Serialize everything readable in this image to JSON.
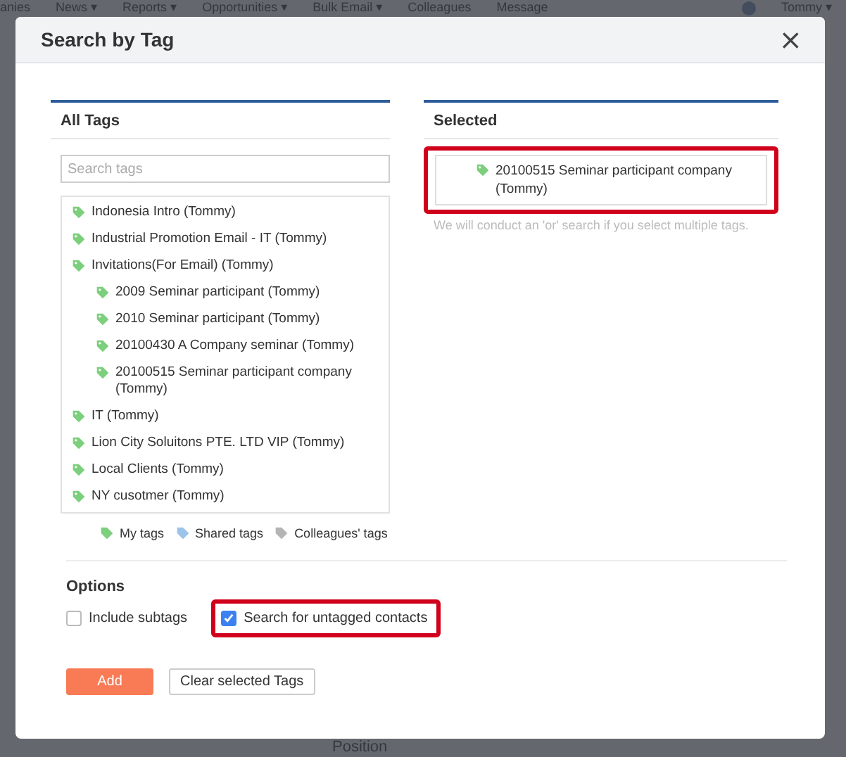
{
  "background": {
    "nav": [
      "anies",
      "News ▾",
      "Reports ▾",
      "Opportunities ▾",
      "Bulk Email ▾",
      "Colleagues",
      "Message"
    ],
    "user": "Tommy ▾",
    "fragments": [
      "Position"
    ]
  },
  "dialog": {
    "title": "Search by Tag",
    "close": "×",
    "all_tags": {
      "heading": "All Tags",
      "search": {
        "placeholder": "Search tags"
      },
      "tags": [
        {
          "label": "Indonesia Intro (Tommy)"
        },
        {
          "label": "Industrial Promotion Email - IT (Tommy)"
        },
        {
          "label": "Invitations(For Email) (Tommy)",
          "children": [
            {
              "label": "2009 Seminar participant (Tommy)"
            },
            {
              "label": "2010 Seminar participant (Tommy)"
            },
            {
              "label": "20100430 A Company seminar (Tommy)"
            },
            {
              "label": "20100515 Seminar participant company (Tommy)"
            }
          ]
        },
        {
          "label": "IT (Tommy)"
        },
        {
          "label": "Lion City Soluitons PTE. LTD VIP (Tommy)"
        },
        {
          "label": "Local Clients (Tommy)"
        },
        {
          "label": "NY cusotmer (Tommy)"
        }
      ],
      "legend": [
        {
          "label": "My tags",
          "color": "#7ccf7c"
        },
        {
          "label": "Shared tags",
          "color": "#9cc3ea"
        },
        {
          "label": "Colleagues' tags",
          "color": "#b5b5b5"
        }
      ]
    },
    "selected": {
      "heading": "Selected",
      "items": [
        {
          "label": "20100515 Seminar participant company (Tommy)",
          "highlighted": true
        }
      ],
      "hint": "We will conduct an 'or' search if you select multiple tags."
    },
    "options": {
      "heading": "Options",
      "items": [
        {
          "label": "Include subtags",
          "checked": false,
          "highlighted": false
        },
        {
          "label": "Search for untagged contacts",
          "checked": true,
          "highlighted": true
        }
      ]
    },
    "buttons": [
      {
        "label": "Add",
        "kind": "primary"
      },
      {
        "label": "Clear selected Tags",
        "kind": "secondary"
      }
    ]
  }
}
